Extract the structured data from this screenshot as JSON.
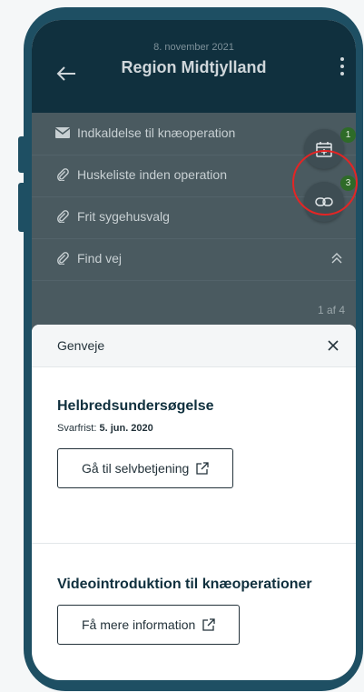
{
  "header": {
    "date": "8. november 2021",
    "title": "Region Midtjylland"
  },
  "list": {
    "items": [
      {
        "label": "Indkaldelse til knæoperation",
        "icon": "envelope-icon"
      },
      {
        "label": "Huskeliste inden operation",
        "icon": "paperclip-icon"
      },
      {
        "label": "Frit sygehusvalg",
        "icon": "paperclip-icon"
      },
      {
        "label": "Find vej",
        "icon": "paperclip-icon"
      }
    ],
    "page_indicator": "1 af 4"
  },
  "fabs": {
    "calendar_badge": "1",
    "link_badge": "3"
  },
  "sheet": {
    "title": "Genveje",
    "section1": {
      "heading": "Helbredsundersøgelse",
      "deadline_label": "Svarfrist:",
      "deadline_value": "5. jun. 2020",
      "button_label": "Gå til selvbetjening"
    },
    "section2": {
      "heading": "Videointroduktion til knæoperationer",
      "button_label": "Få mere information"
    }
  },
  "colors": {
    "header": "#10303e",
    "frame": "#1e4f63",
    "badge": "#2e6b28",
    "highlight": "#e32525"
  }
}
